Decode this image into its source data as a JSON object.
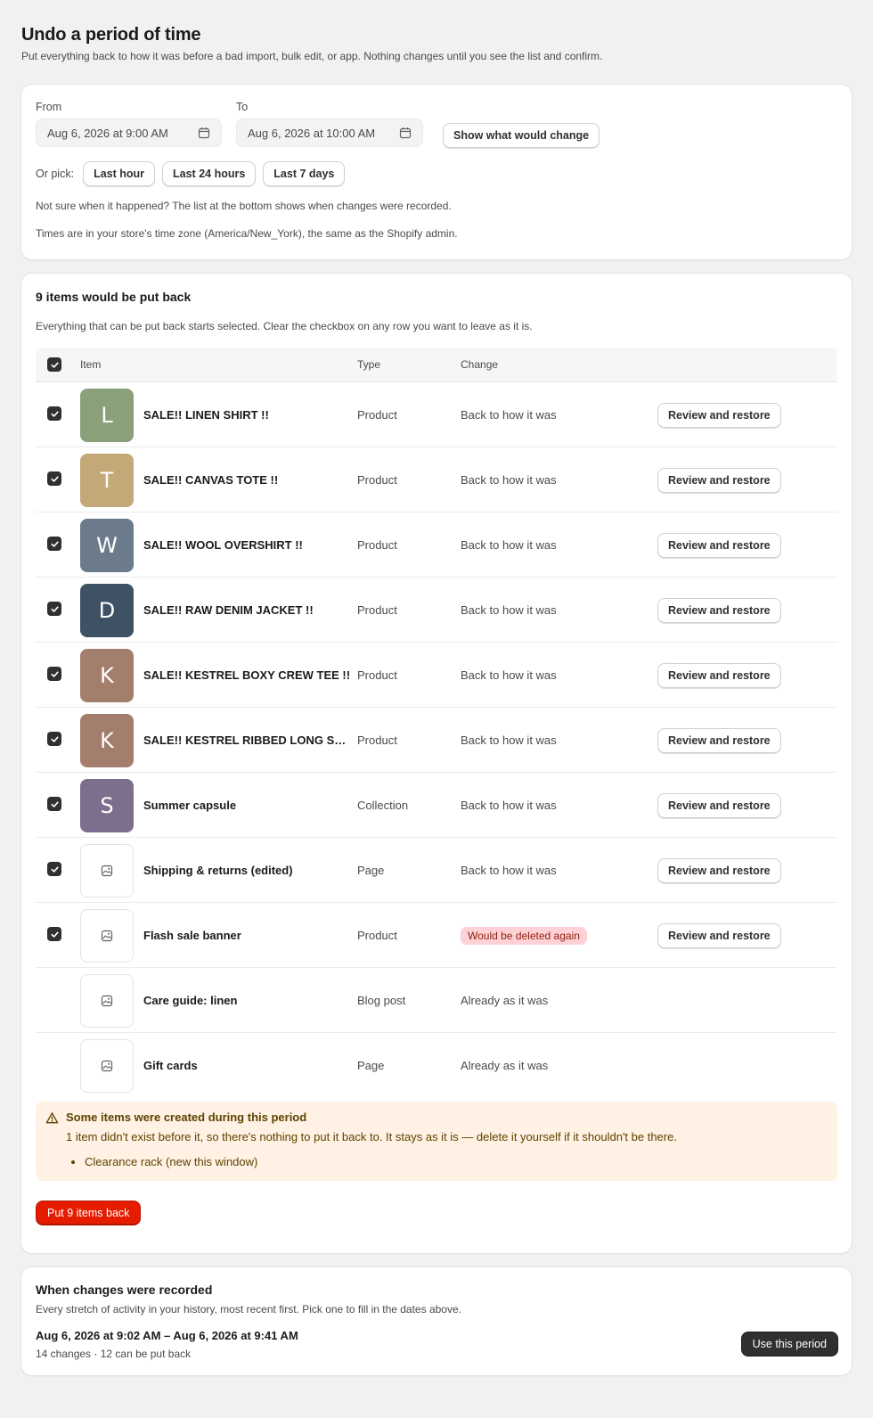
{
  "header": {
    "title": "Undo a period of time",
    "subtitle": "Put everything back to how it was before a bad import, bulk edit, or app. Nothing changes until you see the list and confirm."
  },
  "range": {
    "from_label": "From",
    "from_value": "Aug 6, 2026 at 9:00 AM",
    "to_label": "To",
    "to_value": "Aug 6, 2026 at 10:00 AM",
    "show_button": "Show what would change",
    "pick_label": "Or pick:",
    "quick_picks": [
      "Last hour",
      "Last 24 hours",
      "Last 7 days"
    ],
    "note1": "Not sure when it happened? The list at the bottom shows when changes were recorded.",
    "note2": "Times are in your store's time zone (America/New_York), the same as the Shopify admin."
  },
  "results": {
    "title": "9 items would be put back",
    "subtitle": "Everything that can be put back starts selected. Clear the checkbox on any row you want to leave as it is.",
    "columns": {
      "item": "Item",
      "type": "Type",
      "change": "Change"
    },
    "restore_label": "Review and restore",
    "rows": [
      {
        "initial": "L",
        "color": "#8aa07a",
        "name": "SALE!! LINEN SHIRT !!",
        "type": "Product",
        "change": "Back to how it was",
        "checked": true
      },
      {
        "initial": "T",
        "color": "#c4a978",
        "name": "SALE!! CANVAS TOTE !!",
        "type": "Product",
        "change": "Back to how it was",
        "checked": true
      },
      {
        "initial": "W",
        "color": "#6c7b8b",
        "name": "SALE!! WOOL OVERSHIRT !!",
        "type": "Product",
        "change": "Back to how it was",
        "checked": true
      },
      {
        "initial": "D",
        "color": "#3f5164",
        "name": "SALE!! RAW DENIM JACKET !!",
        "type": "Product",
        "change": "Back to how it was",
        "checked": true
      },
      {
        "initial": "K",
        "color": "#a47e6c",
        "name": "SALE!! KESTREL BOXY CREW TEE !!",
        "type": "Product",
        "change": "Back to how it was",
        "checked": true
      },
      {
        "initial": "K",
        "color": "#a47e6c",
        "name": "SALE!! KESTREL RIBBED LONG SL…",
        "type": "Product",
        "change": "Back to how it was",
        "checked": true
      },
      {
        "initial": "S",
        "color": "#7d6e8e",
        "name": "Summer capsule",
        "type": "Collection",
        "change": "Back to how it was",
        "checked": true
      },
      {
        "initial": "",
        "color": "",
        "name": "Shipping & returns (edited)",
        "type": "Page",
        "change": "Back to how it was",
        "checked": true
      },
      {
        "initial": "",
        "color": "",
        "name": "Flash sale banner",
        "type": "Product",
        "change": "Would be deleted again",
        "checked": true,
        "badge": true
      },
      {
        "initial": "",
        "color": "",
        "name": "Care guide: linen",
        "type": "Blog post",
        "change": "Already as it was",
        "checked": false
      },
      {
        "initial": "",
        "color": "",
        "name": "Gift cards",
        "type": "Page",
        "change": "Already as it was",
        "checked": false
      }
    ],
    "banner": {
      "title": "Some items were created during this period",
      "body": "1 item didn't exist before it, so there's nothing to put it back to. It stays as it is — delete it yourself if it shouldn't be there.",
      "items": [
        "Clearance rack (new this window)"
      ]
    },
    "primary_button": "Put 9 items back"
  },
  "history": {
    "title": "When changes were recorded",
    "subtitle": "Every stretch of activity in your history, most recent first. Pick one to fill in the dates above.",
    "range": "Aug 6, 2026 at 9:02 AM – Aug 6, 2026 at 9:41 AM",
    "meta": "14 changes · 12 can be put back",
    "button": "Use this period"
  },
  "colors": {
    "primary": "#e51c00",
    "dark_button": "#303030",
    "warning_bg": "#fff1e3",
    "critical_badge_bg": "#fed1d7"
  }
}
